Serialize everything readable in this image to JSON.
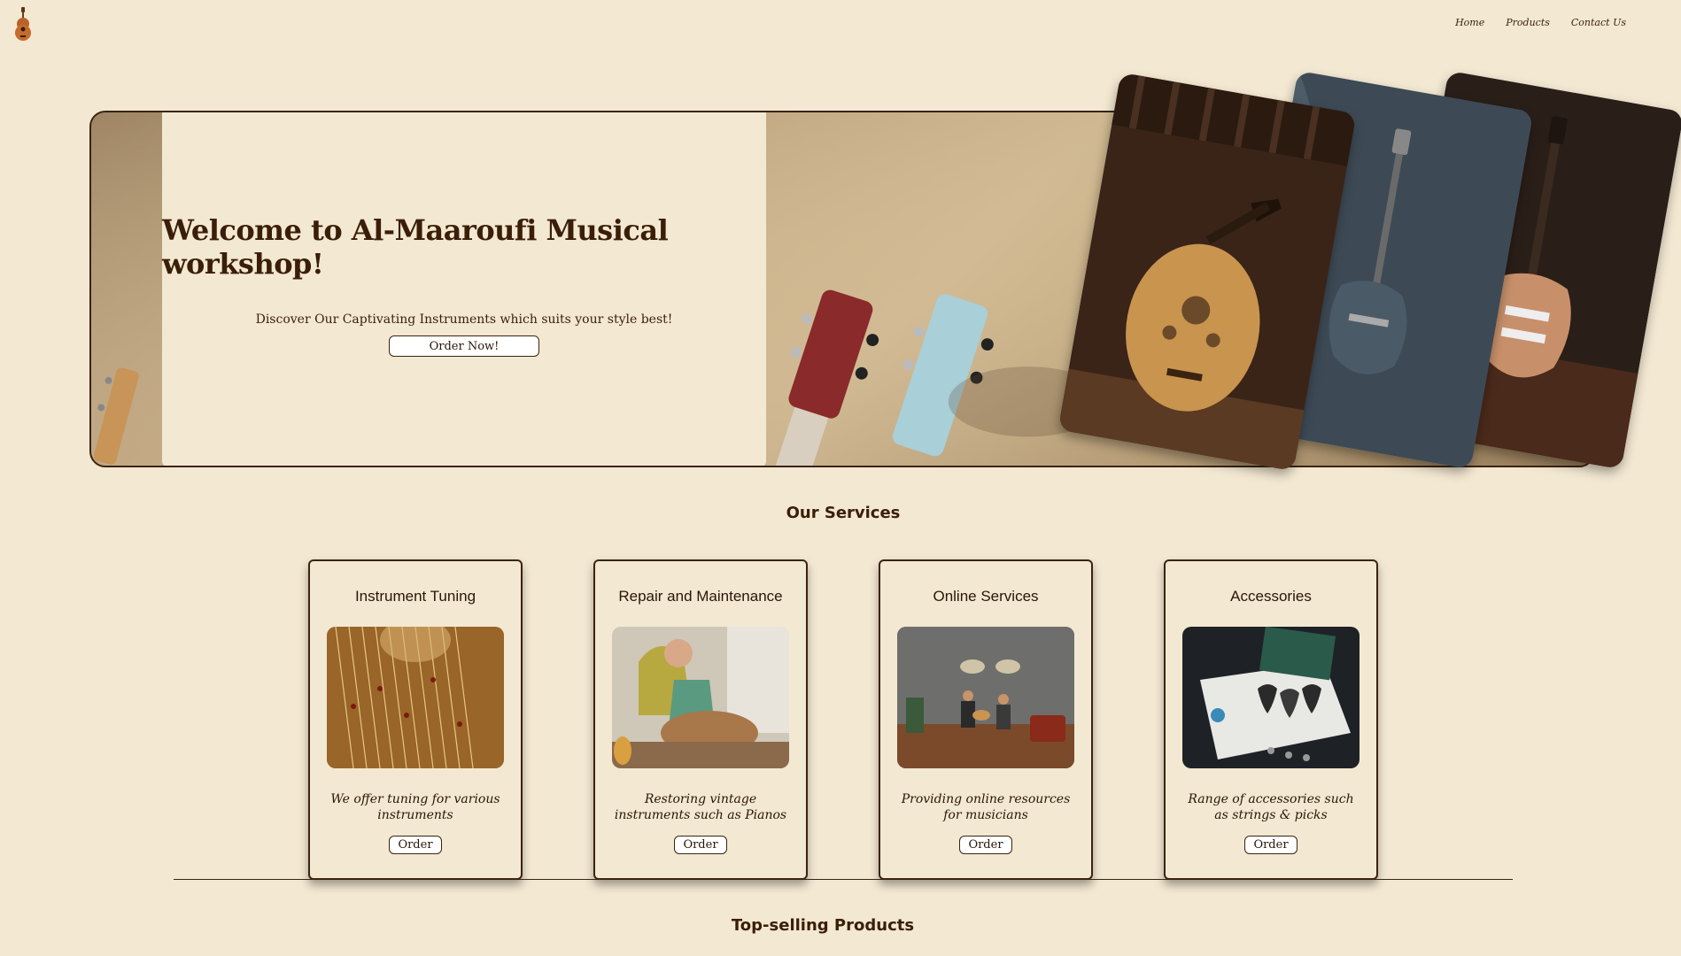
{
  "header": {
    "nav": [
      "Home",
      "Products",
      "Contact Us"
    ]
  },
  "hero": {
    "title": "Welcome to Al-Maaroufi Musical workshop!",
    "subtitle": "Discover Our Captivating Instruments which suits your style best!",
    "button": "Order Now!"
  },
  "services": {
    "title": "Our Services",
    "cards": [
      {
        "title": "Instrument Tuning",
        "desc": "We offer tuning for various instruments",
        "button": "Order",
        "image": "harp-strings"
      },
      {
        "title": "Repair and Maintenance",
        "desc": "Restoring vintage instruments such as Pianos",
        "button": "Order",
        "image": "luthier-workshop"
      },
      {
        "title": "Online Services",
        "desc": "Providing online resources for musicians",
        "button": "Order",
        "image": "musicians-studio"
      },
      {
        "title": "Accessories",
        "desc": "Range of accessories such as strings & picks",
        "button": "Order",
        "image": "guitar-picks"
      }
    ]
  },
  "top_selling": {
    "title": "Top-selling Products"
  },
  "colors": {
    "background": "#f3e8d2",
    "text": "#3a2410"
  }
}
